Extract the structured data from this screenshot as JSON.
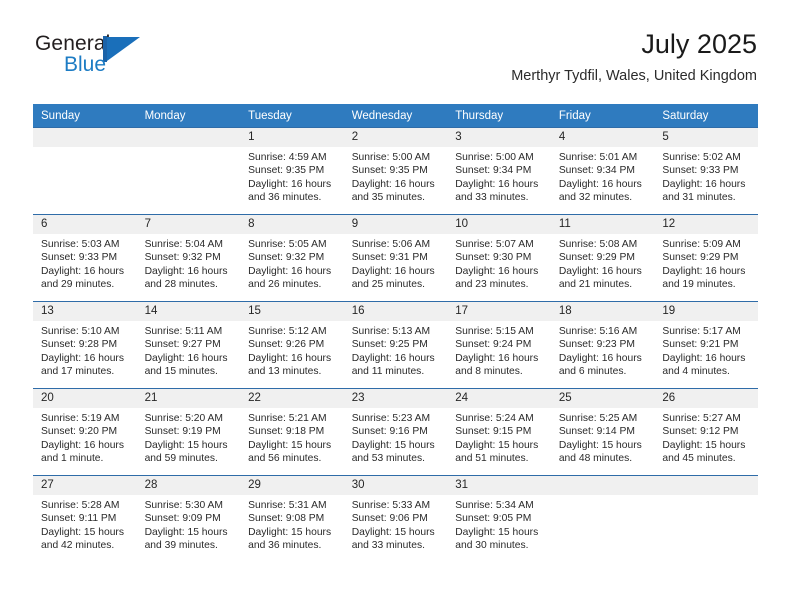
{
  "brand": {
    "name_part1": "General",
    "name_part2": "Blue",
    "flag_icon": "general-blue-flag-logo"
  },
  "header": {
    "title": "July 2025",
    "subtitle": "Merthyr Tydfil, Wales, United Kingdom"
  },
  "colors": {
    "header_blue": "#2f7bbf",
    "row_border_blue": "#2f6ca8",
    "daynum_band": "#f0f0f0",
    "brand_blue": "#1d7cc4"
  },
  "weekday_headers": [
    "Sunday",
    "Monday",
    "Tuesday",
    "Wednesday",
    "Thursday",
    "Friday",
    "Saturday"
  ],
  "weeks": [
    [
      {
        "day": "",
        "empty": true
      },
      {
        "day": "",
        "empty": true
      },
      {
        "day": "1",
        "sunrise": "Sunrise: 4:59 AM",
        "sunset": "Sunset: 9:35 PM",
        "daylight": "Daylight: 16 hours and 36 minutes."
      },
      {
        "day": "2",
        "sunrise": "Sunrise: 5:00 AM",
        "sunset": "Sunset: 9:35 PM",
        "daylight": "Daylight: 16 hours and 35 minutes."
      },
      {
        "day": "3",
        "sunrise": "Sunrise: 5:00 AM",
        "sunset": "Sunset: 9:34 PM",
        "daylight": "Daylight: 16 hours and 33 minutes."
      },
      {
        "day": "4",
        "sunrise": "Sunrise: 5:01 AM",
        "sunset": "Sunset: 9:34 PM",
        "daylight": "Daylight: 16 hours and 32 minutes."
      },
      {
        "day": "5",
        "sunrise": "Sunrise: 5:02 AM",
        "sunset": "Sunset: 9:33 PM",
        "daylight": "Daylight: 16 hours and 31 minutes."
      }
    ],
    [
      {
        "day": "6",
        "sunrise": "Sunrise: 5:03 AM",
        "sunset": "Sunset: 9:33 PM",
        "daylight": "Daylight: 16 hours and 29 minutes."
      },
      {
        "day": "7",
        "sunrise": "Sunrise: 5:04 AM",
        "sunset": "Sunset: 9:32 PM",
        "daylight": "Daylight: 16 hours and 28 minutes."
      },
      {
        "day": "8",
        "sunrise": "Sunrise: 5:05 AM",
        "sunset": "Sunset: 9:32 PM",
        "daylight": "Daylight: 16 hours and 26 minutes."
      },
      {
        "day": "9",
        "sunrise": "Sunrise: 5:06 AM",
        "sunset": "Sunset: 9:31 PM",
        "daylight": "Daylight: 16 hours and 25 minutes."
      },
      {
        "day": "10",
        "sunrise": "Sunrise: 5:07 AM",
        "sunset": "Sunset: 9:30 PM",
        "daylight": "Daylight: 16 hours and 23 minutes."
      },
      {
        "day": "11",
        "sunrise": "Sunrise: 5:08 AM",
        "sunset": "Sunset: 9:29 PM",
        "daylight": "Daylight: 16 hours and 21 minutes."
      },
      {
        "day": "12",
        "sunrise": "Sunrise: 5:09 AM",
        "sunset": "Sunset: 9:29 PM",
        "daylight": "Daylight: 16 hours and 19 minutes."
      }
    ],
    [
      {
        "day": "13",
        "sunrise": "Sunrise: 5:10 AM",
        "sunset": "Sunset: 9:28 PM",
        "daylight": "Daylight: 16 hours and 17 minutes."
      },
      {
        "day": "14",
        "sunrise": "Sunrise: 5:11 AM",
        "sunset": "Sunset: 9:27 PM",
        "daylight": "Daylight: 16 hours and 15 minutes."
      },
      {
        "day": "15",
        "sunrise": "Sunrise: 5:12 AM",
        "sunset": "Sunset: 9:26 PM",
        "daylight": "Daylight: 16 hours and 13 minutes."
      },
      {
        "day": "16",
        "sunrise": "Sunrise: 5:13 AM",
        "sunset": "Sunset: 9:25 PM",
        "daylight": "Daylight: 16 hours and 11 minutes."
      },
      {
        "day": "17",
        "sunrise": "Sunrise: 5:15 AM",
        "sunset": "Sunset: 9:24 PM",
        "daylight": "Daylight: 16 hours and 8 minutes."
      },
      {
        "day": "18",
        "sunrise": "Sunrise: 5:16 AM",
        "sunset": "Sunset: 9:23 PM",
        "daylight": "Daylight: 16 hours and 6 minutes."
      },
      {
        "day": "19",
        "sunrise": "Sunrise: 5:17 AM",
        "sunset": "Sunset: 9:21 PM",
        "daylight": "Daylight: 16 hours and 4 minutes."
      }
    ],
    [
      {
        "day": "20",
        "sunrise": "Sunrise: 5:19 AM",
        "sunset": "Sunset: 9:20 PM",
        "daylight": "Daylight: 16 hours and 1 minute."
      },
      {
        "day": "21",
        "sunrise": "Sunrise: 5:20 AM",
        "sunset": "Sunset: 9:19 PM",
        "daylight": "Daylight: 15 hours and 59 minutes."
      },
      {
        "day": "22",
        "sunrise": "Sunrise: 5:21 AM",
        "sunset": "Sunset: 9:18 PM",
        "daylight": "Daylight: 15 hours and 56 minutes."
      },
      {
        "day": "23",
        "sunrise": "Sunrise: 5:23 AM",
        "sunset": "Sunset: 9:16 PM",
        "daylight": "Daylight: 15 hours and 53 minutes."
      },
      {
        "day": "24",
        "sunrise": "Sunrise: 5:24 AM",
        "sunset": "Sunset: 9:15 PM",
        "daylight": "Daylight: 15 hours and 51 minutes."
      },
      {
        "day": "25",
        "sunrise": "Sunrise: 5:25 AM",
        "sunset": "Sunset: 9:14 PM",
        "daylight": "Daylight: 15 hours and 48 minutes."
      },
      {
        "day": "26",
        "sunrise": "Sunrise: 5:27 AM",
        "sunset": "Sunset: 9:12 PM",
        "daylight": "Daylight: 15 hours and 45 minutes."
      }
    ],
    [
      {
        "day": "27",
        "sunrise": "Sunrise: 5:28 AM",
        "sunset": "Sunset: 9:11 PM",
        "daylight": "Daylight: 15 hours and 42 minutes."
      },
      {
        "day": "28",
        "sunrise": "Sunrise: 5:30 AM",
        "sunset": "Sunset: 9:09 PM",
        "daylight": "Daylight: 15 hours and 39 minutes."
      },
      {
        "day": "29",
        "sunrise": "Sunrise: 5:31 AM",
        "sunset": "Sunset: 9:08 PM",
        "daylight": "Daylight: 15 hours and 36 minutes."
      },
      {
        "day": "30",
        "sunrise": "Sunrise: 5:33 AM",
        "sunset": "Sunset: 9:06 PM",
        "daylight": "Daylight: 15 hours and 33 minutes."
      },
      {
        "day": "31",
        "sunrise": "Sunrise: 5:34 AM",
        "sunset": "Sunset: 9:05 PM",
        "daylight": "Daylight: 15 hours and 30 minutes."
      },
      {
        "day": "",
        "empty": true
      },
      {
        "day": "",
        "empty": true
      }
    ]
  ]
}
